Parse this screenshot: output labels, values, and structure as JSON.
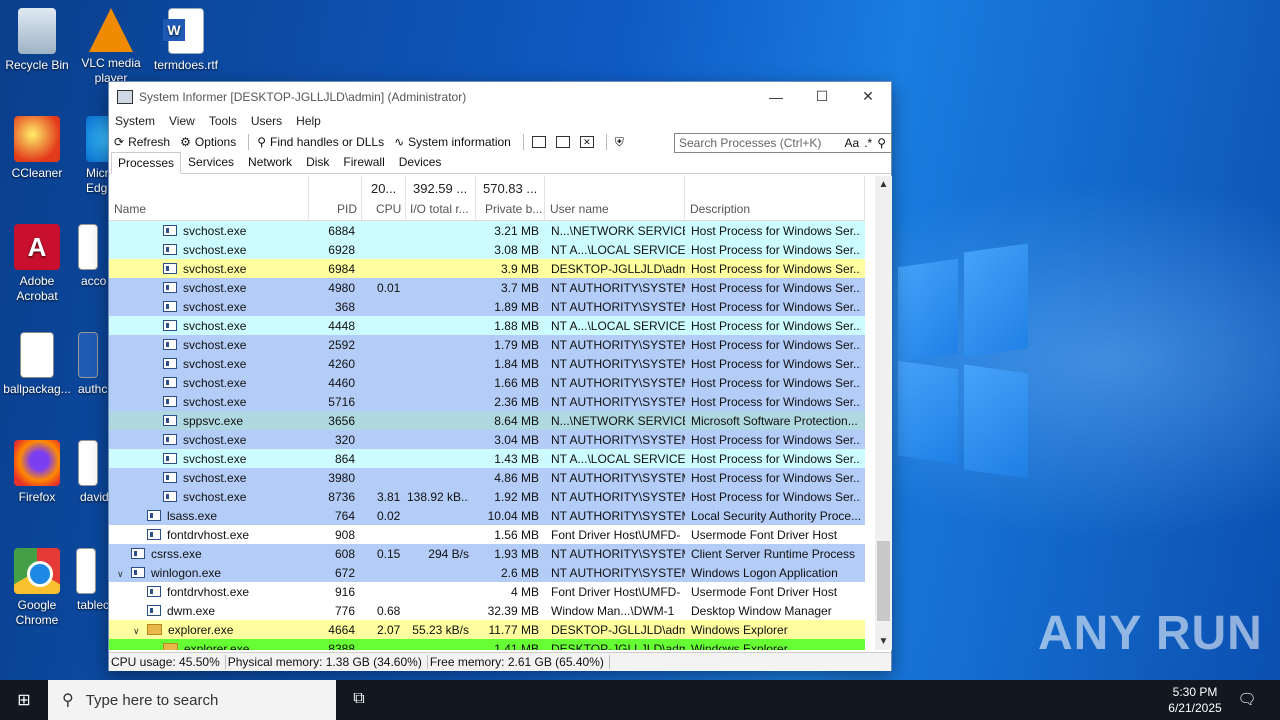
{
  "desktop": {
    "icons": [
      {
        "label": "Recycle Bin",
        "icon": "recycle-bin-icon"
      },
      {
        "label": "VLC media player",
        "icon": "vlc-icon"
      },
      {
        "label": "termdoes.rtf",
        "icon": "word-document-icon"
      },
      {
        "label": "CCleaner",
        "icon": "ccleaner-icon"
      },
      {
        "label": "Microsoft Edge",
        "icon": "edge-icon"
      },
      {
        "label": "Adobe Acrobat",
        "icon": "adobe-acrobat-icon"
      },
      {
        "label": "acco",
        "icon": "word-document-icon"
      },
      {
        "label": "ballpackag...",
        "icon": "image-file-icon"
      },
      {
        "label": "authc",
        "icon": "word-document-icon"
      },
      {
        "label": "Firefox",
        "icon": "firefox-icon"
      },
      {
        "label": "david",
        "icon": "document-icon"
      },
      {
        "label": "Google Chrome",
        "icon": "chrome-icon"
      },
      {
        "label": "tablec",
        "icon": "document-icon"
      }
    ],
    "watermark": "ANY RUN"
  },
  "window": {
    "title": "System Informer [DESKTOP-JGLLJLD\\admin] (Administrator)",
    "controls": {
      "minimize": "—",
      "maximize": "☐",
      "close": "✕"
    },
    "menu": [
      "System",
      "View",
      "Tools",
      "Users",
      "Help"
    ],
    "toolbar": {
      "refresh": "Refresh",
      "options": "Options",
      "find_handles": "Find handles or DLLs",
      "system_info": "System information"
    },
    "search": {
      "placeholder": "Search Processes (Ctrl+K)",
      "case_label": "Aa",
      "regex_label": ".*"
    },
    "tabs": [
      "Processes",
      "Services",
      "Network",
      "Disk",
      "Firewall",
      "Devices"
    ],
    "active_tab": "Processes",
    "columns": {
      "name": "Name",
      "pid": "PID",
      "cpu": "CPU",
      "io": "I/O total r...",
      "private": "Private b...",
      "user": "User name",
      "description": "Description",
      "cpu_total": "20...",
      "io_total": "392.59 ...",
      "private_total": "570.83 ..."
    },
    "rows": [
      {
        "name": "svchost.exe",
        "indent": 3,
        "pid": "6884",
        "cpu": "",
        "io": "",
        "private": "3.21 MB",
        "user": "N...\\NETWORK SERVICE",
        "desc": "Host Process for Windows Ser...",
        "color": "#ccfcff"
      },
      {
        "name": "svchost.exe",
        "indent": 3,
        "pid": "6928",
        "cpu": "",
        "io": "",
        "private": "3.08 MB",
        "user": "NT A...\\LOCAL SERVICE",
        "desc": "Host Process for Windows Ser...",
        "color": "#ccfcff"
      },
      {
        "name": "svchost.exe",
        "indent": 3,
        "pid": "6984",
        "cpu": "",
        "io": "",
        "private": "3.9 MB",
        "user": "DESKTOP-JGLLJLD\\admi",
        "desc": "Host Process for Windows Ser...",
        "color": "#ffff9f"
      },
      {
        "name": "svchost.exe",
        "indent": 3,
        "pid": "4980",
        "cpu": "0.01",
        "io": "",
        "private": "3.7 MB",
        "user": "NT AUTHORITY\\SYSTEM",
        "desc": "Host Process for Windows Ser...",
        "color": "#b4cdf8"
      },
      {
        "name": "svchost.exe",
        "indent": 3,
        "pid": "368",
        "cpu": "",
        "io": "",
        "private": "1.89 MB",
        "user": "NT AUTHORITY\\SYSTEM",
        "desc": "Host Process for Windows Ser...",
        "color": "#b4cdf8"
      },
      {
        "name": "svchost.exe",
        "indent": 3,
        "pid": "4448",
        "cpu": "",
        "io": "",
        "private": "1.88 MB",
        "user": "NT A...\\LOCAL SERVICE",
        "desc": "Host Process for Windows Ser...",
        "color": "#ccfcff"
      },
      {
        "name": "svchost.exe",
        "indent": 3,
        "pid": "2592",
        "cpu": "",
        "io": "",
        "private": "1.79 MB",
        "user": "NT AUTHORITY\\SYSTEM",
        "desc": "Host Process for Windows Ser...",
        "color": "#b4cdf8"
      },
      {
        "name": "svchost.exe",
        "indent": 3,
        "pid": "4260",
        "cpu": "",
        "io": "",
        "private": "1.84 MB",
        "user": "NT AUTHORITY\\SYSTEM",
        "desc": "Host Process for Windows Ser...",
        "color": "#b4cdf8"
      },
      {
        "name": "svchost.exe",
        "indent": 3,
        "pid": "4460",
        "cpu": "",
        "io": "",
        "private": "1.66 MB",
        "user": "NT AUTHORITY\\SYSTEM",
        "desc": "Host Process for Windows Ser...",
        "color": "#b4cdf8"
      },
      {
        "name": "svchost.exe",
        "indent": 3,
        "pid": "5716",
        "cpu": "",
        "io": "",
        "private": "2.36 MB",
        "user": "NT AUTHORITY\\SYSTEM",
        "desc": "Host Process for Windows Ser...",
        "color": "#b4cdf8"
      },
      {
        "name": "sppsvc.exe",
        "indent": 3,
        "pid": "3656",
        "cpu": "",
        "io": "",
        "private": "8.64 MB",
        "user": "N...\\NETWORK SERVICE",
        "desc": "Microsoft Software Protection...",
        "color": "#b0d8e0"
      },
      {
        "name": "svchost.exe",
        "indent": 3,
        "pid": "320",
        "cpu": "",
        "io": "",
        "private": "3.04 MB",
        "user": "NT AUTHORITY\\SYSTEM",
        "desc": "Host Process for Windows Ser...",
        "color": "#b4cdf8"
      },
      {
        "name": "svchost.exe",
        "indent": 3,
        "pid": "864",
        "cpu": "",
        "io": "",
        "private": "1.43 MB",
        "user": "NT A...\\LOCAL SERVICE",
        "desc": "Host Process for Windows Ser...",
        "color": "#ccfcff"
      },
      {
        "name": "svchost.exe",
        "indent": 3,
        "pid": "3980",
        "cpu": "",
        "io": "",
        "private": "4.86 MB",
        "user": "NT AUTHORITY\\SYSTEM",
        "desc": "Host Process for Windows Ser...",
        "color": "#b4cdf8"
      },
      {
        "name": "svchost.exe",
        "indent": 3,
        "pid": "8736",
        "cpu": "3.81",
        "io": "138.92 kB...",
        "private": "1.92 MB",
        "user": "NT AUTHORITY\\SYSTEM",
        "desc": "Host Process for Windows Ser...",
        "color": "#b4cdf8"
      },
      {
        "name": "lsass.exe",
        "indent": 2,
        "pid": "764",
        "cpu": "0.02",
        "io": "",
        "private": "10.04 MB",
        "user": "NT AUTHORITY\\SYSTEM",
        "desc": "Local Security Authority Proce...",
        "color": "#b4cdf8"
      },
      {
        "name": "fontdrvhost.exe",
        "indent": 2,
        "pid": "908",
        "cpu": "",
        "io": "",
        "private": "1.56 MB",
        "user": "Font Driver Host\\UMFD-",
        "desc": "Usermode Font Driver Host",
        "color": "#ffffff"
      },
      {
        "name": "csrss.exe",
        "indent": 1,
        "pid": "608",
        "cpu": "0.15",
        "io": "294 B/s",
        "private": "1.93 MB",
        "user": "NT AUTHORITY\\SYSTEM",
        "desc": "Client Server Runtime Process",
        "color": "#b4cdf8"
      },
      {
        "name": "winlogon.exe",
        "indent": 1,
        "pid": "672",
        "cpu": "",
        "io": "",
        "private": "2.6 MB",
        "user": "NT AUTHORITY\\SYSTEM",
        "desc": "Windows Logon Application",
        "color": "#b4cdf8",
        "expanded": true
      },
      {
        "name": "fontdrvhost.exe",
        "indent": 2,
        "pid": "916",
        "cpu": "",
        "io": "",
        "private": "4 MB",
        "user": "Font Driver Host\\UMFD-",
        "desc": "Usermode Font Driver Host",
        "color": "#ffffff"
      },
      {
        "name": "dwm.exe",
        "indent": 2,
        "pid": "776",
        "cpu": "0.68",
        "io": "",
        "private": "32.39 MB",
        "user": "Window Man...\\DWM-1",
        "desc": "Desktop Window Manager",
        "color": "#ffffff"
      },
      {
        "name": "explorer.exe",
        "indent": 2,
        "pid": "4664",
        "cpu": "2.07",
        "io": "55.23 kB/s",
        "private": "11.77 MB",
        "user": "DESKTOP-JGLLJLD\\admi",
        "desc": "Windows Explorer",
        "color": "#ffff9f",
        "expanded": true,
        "folder": true
      },
      {
        "name": "explorer.exe",
        "indent": 3,
        "pid": "8388",
        "cpu": "",
        "io": "",
        "private": "1.41 MB",
        "user": "DESKTOP-JGLLJLD\\admi",
        "desc": "Windows Explorer",
        "color": "#66ff33",
        "folder": true
      }
    ],
    "status": {
      "cpu": "CPU usage: 45.50%",
      "physical": "Physical memory: 1.38 GB (34.60%)",
      "free": "Free memory: 2.61 GB (65.40%)"
    }
  },
  "taskbar": {
    "search_placeholder": "Type here to search",
    "time": "5:30 PM",
    "date": "6/21/2025"
  }
}
